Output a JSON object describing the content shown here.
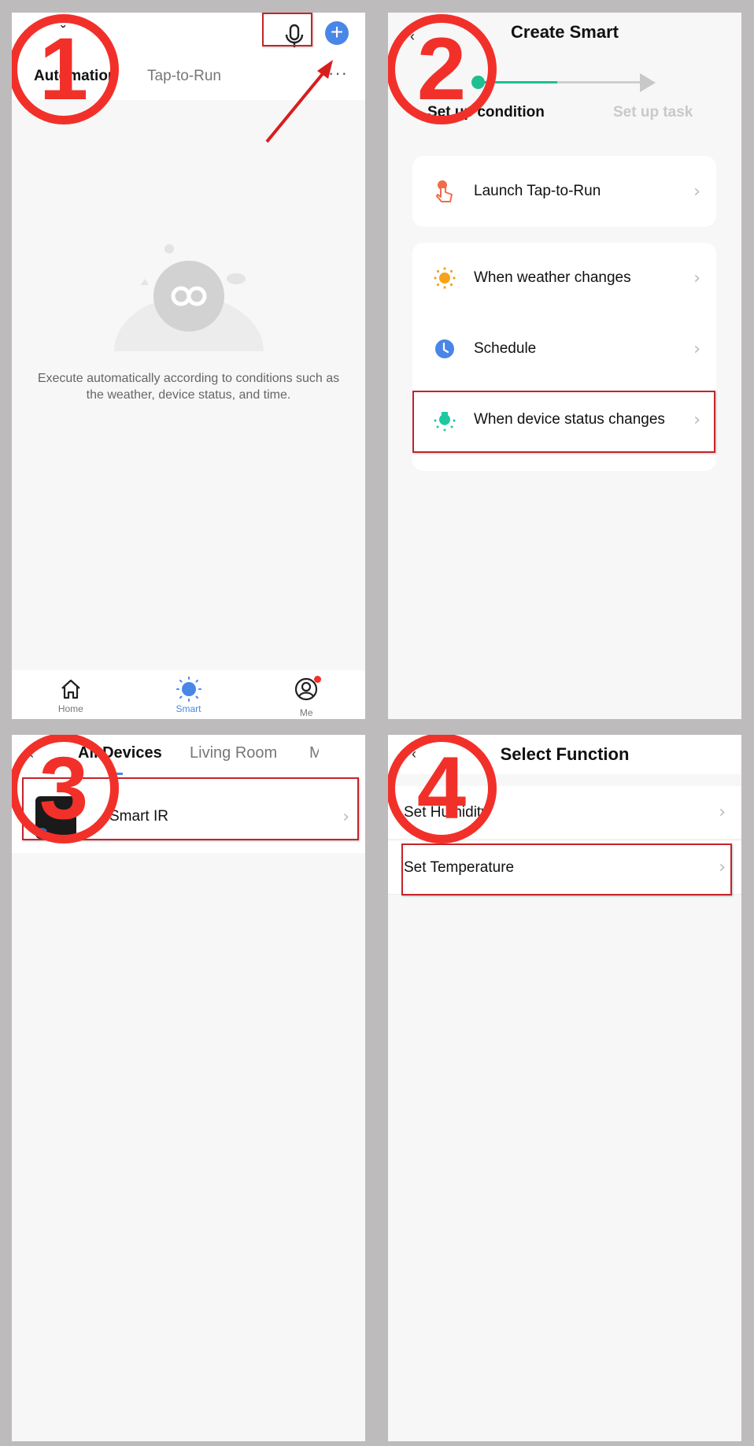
{
  "colors": {
    "accent_blue": "#4a86e8",
    "accent_green": "#1fbf8f",
    "annotation_red": "#f2302a",
    "highlight_box": "#c4242a",
    "background": "#bdbbbb"
  },
  "steps": [
    "1",
    "2",
    "3",
    "4"
  ],
  "panel1": {
    "home_switch_icon": "chevron-down-icon",
    "tabs": [
      {
        "label": "Automation",
        "active": true
      },
      {
        "label": "Tap-to-Run",
        "active": false
      }
    ],
    "header_icons": [
      "microphone-icon",
      "add-icon",
      "more-icon"
    ],
    "more_label": "···",
    "empty_message": "Execute automatically according to conditions such as the weather, device status, and time.",
    "bottom_nav": [
      {
        "label": "Home",
        "icon": "home-icon",
        "active": false
      },
      {
        "label": "Smart",
        "icon": "smart-sun-icon",
        "active": true
      },
      {
        "label": "Me",
        "icon": "profile-icon",
        "active": false,
        "badge": true
      }
    ]
  },
  "panel2": {
    "back_icon": "back-icon",
    "title": "Create Smart",
    "progress_steps": [
      {
        "label": "Set up condition",
        "active": true
      },
      {
        "label": "Set up task",
        "active": false
      }
    ],
    "progress_fraction": 0.5,
    "conditions": [
      {
        "label": "Launch Tap-to-Run",
        "icon": "tap-hand-icon",
        "color": "#f26b4a"
      },
      {
        "label": "When weather changes",
        "icon": "weather-sun-icon",
        "color": "#f7a21b"
      },
      {
        "label": "Schedule",
        "icon": "clock-icon",
        "color": "#4a86e8"
      },
      {
        "label": "When device status changes",
        "icon": "device-bulb-icon",
        "color": "#1fc8a0",
        "highlighted": true
      }
    ]
  },
  "panel3": {
    "back_icon": "back-icon",
    "room_tabs": [
      {
        "label": "All Devices",
        "active": true
      },
      {
        "label": "Living Room",
        "active": false
      },
      {
        "label": "M",
        "active": false
      }
    ],
    "devices": [
      {
        "label": "Smart IR",
        "icon": "smart-ir-device-icon",
        "highlighted": true
      }
    ]
  },
  "panel4": {
    "back_icon": "back-icon",
    "title": "Select Function",
    "functions": [
      {
        "label": "Set Humidity",
        "highlighted": false
      },
      {
        "label": "Set Temperature",
        "highlighted": true
      }
    ]
  }
}
